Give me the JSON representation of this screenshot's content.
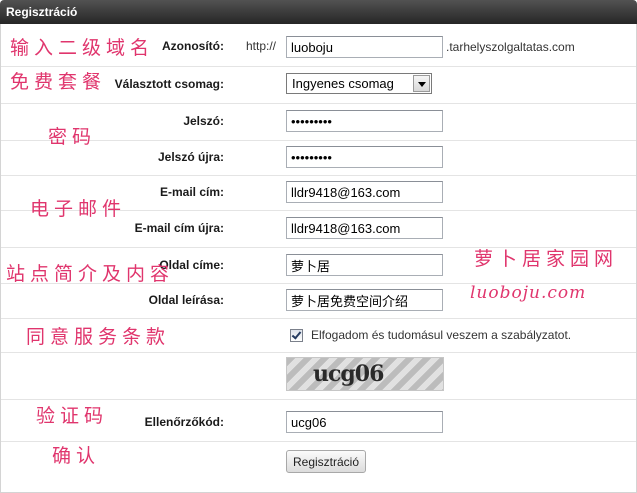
{
  "window": {
    "title": "Regisztráció"
  },
  "colors": {
    "annotation": "#e0356d"
  },
  "form": {
    "subdomain": {
      "label": "Azonosító:",
      "prefix": "http://",
      "value": "luoboju",
      "suffix": ".tarhelyszolgaltatas.com"
    },
    "package": {
      "label": "Választott csomag:",
      "selected": "Ingyenes csomag"
    },
    "password": {
      "label": "Jelszó:",
      "value": "•••••••••"
    },
    "password_repeat": {
      "label": "Jelszó újra:",
      "value": "•••••••••"
    },
    "email": {
      "label": "E-mail cím:",
      "value": "lldr9418@163.com"
    },
    "email_repeat": {
      "label": "E-mail cím újra:",
      "value": "lldr9418@163.com"
    },
    "site_title": {
      "label": "Oldal címe:",
      "value": "萝卜居"
    },
    "site_description": {
      "label": "Oldal leírása:",
      "value": "萝卜居免费空间介绍"
    },
    "terms": {
      "checked": true,
      "label": "Elfogadom és tudomásul veszem a szabályzatot."
    },
    "captcha": {
      "image_text": "ucg06"
    },
    "verification": {
      "label": "Ellenőrzőkód:",
      "value": "ucg06"
    },
    "submit_label": "Regisztráció"
  },
  "annotations": {
    "subdomain": "输入二级域名",
    "package": "免费套餐",
    "password": "密码",
    "email": "电子邮件",
    "site_info": "站点简介及内容",
    "terms": "同意服务条款",
    "captcha": "验证码",
    "confirm": "确认",
    "site_name": "萝卜居家园网",
    "site_url": "luoboju.com"
  }
}
